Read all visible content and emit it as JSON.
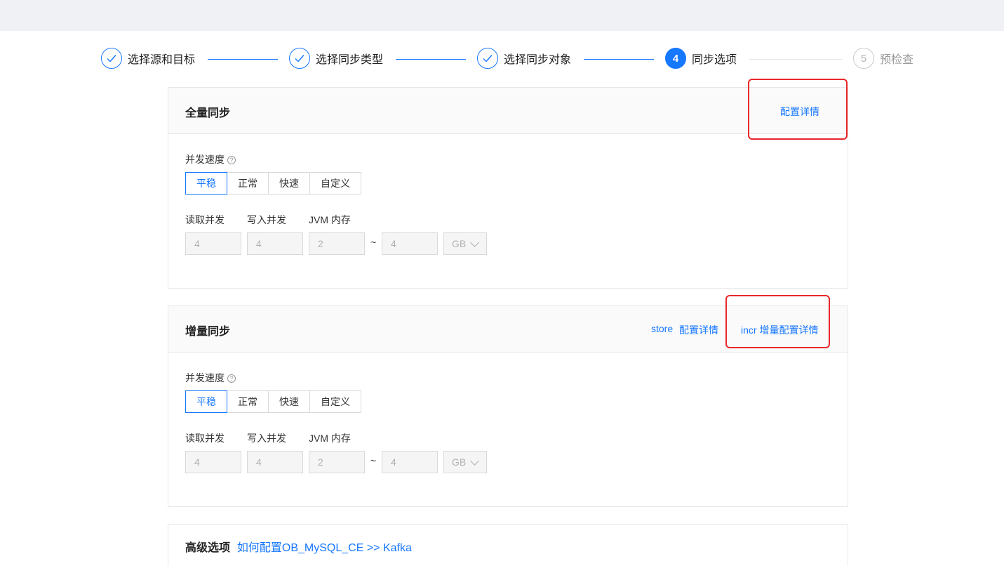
{
  "steps": [
    {
      "label": "选择源和目标",
      "state": "done"
    },
    {
      "label": "选择同步类型",
      "state": "done"
    },
    {
      "label": "选择同步对象",
      "state": "done"
    },
    {
      "label": "同步选项",
      "state": "active",
      "number": "4"
    },
    {
      "label": "预检查",
      "state": "wait",
      "number": "5"
    }
  ],
  "full_sync": {
    "title": "全量同步",
    "config_link": "配置详情",
    "concurrency_label": "并发速度",
    "help_icon": "?",
    "speed_options": [
      "平稳",
      "正常",
      "快速",
      "自定义"
    ],
    "selected_speed": "平稳",
    "read_label": "读取并发",
    "write_label": "写入并发",
    "jvm_label": "JVM 内存",
    "read_value": "4",
    "write_value": "4",
    "jvm_min": "2",
    "tilde": "~",
    "jvm_max": "4",
    "unit": "GB"
  },
  "incr_sync": {
    "title": "增量同步",
    "store_link": "store",
    "store_config_link": "配置详情",
    "incr_config_link": "incr 增量配置详情",
    "concurrency_label": "并发速度",
    "help_icon": "?",
    "speed_options": [
      "平稳",
      "正常",
      "快速",
      "自定义"
    ],
    "selected_speed": "平稳",
    "read_label": "读取并发",
    "write_label": "写入并发",
    "jvm_label": "JVM 内存",
    "read_value": "4",
    "write_value": "4",
    "jvm_min": "2",
    "tilde": "~",
    "jvm_max": "4",
    "unit": "GB"
  },
  "advanced": {
    "title": "高级选项",
    "help_link": "如何配置OB_MySQL_CE >> Kafka"
  },
  "colors": {
    "primary": "#1677ff",
    "highlight": "#e8282b"
  }
}
